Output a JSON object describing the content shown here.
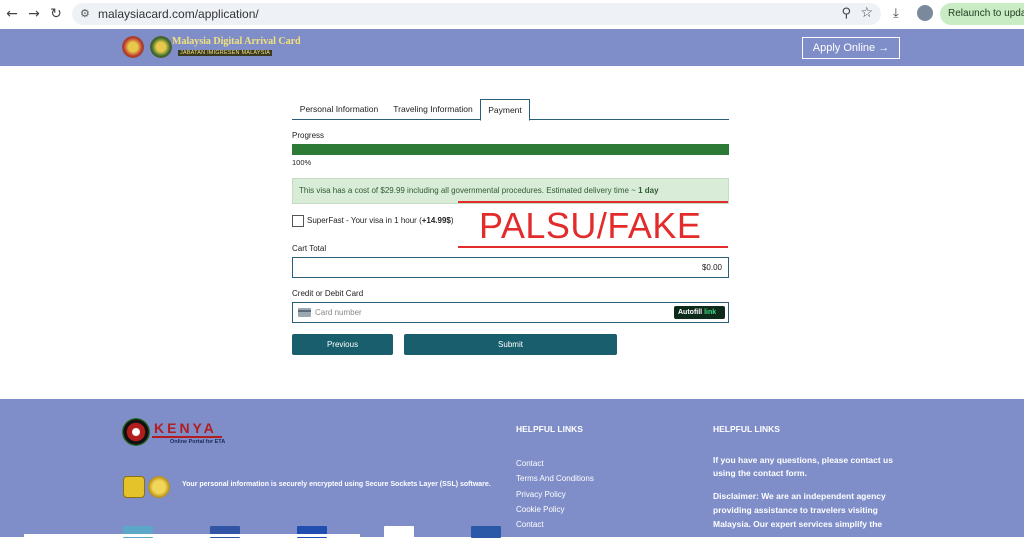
{
  "browser": {
    "url": "malaysiacard.com/application/",
    "relaunch_label": "Relaunch to update"
  },
  "header": {
    "brand_title": "Malaysia Digital Arrival Card",
    "brand_subtitle": "JABATAN IMIGRESEN MALAYSIA",
    "apply_button": "Apply Online →"
  },
  "tabs": [
    {
      "label": "Personal Information"
    },
    {
      "label": "Traveling Information"
    },
    {
      "label": "Payment"
    }
  ],
  "progress": {
    "label": "Progress",
    "value_text": "100%",
    "fraction": 1.0
  },
  "alert": {
    "text_before": "This visa has a cost of $29.99 including all governmental procedures. Estimated delivery time ~ ",
    "text_bold": "1 day"
  },
  "stamp": {
    "text": "PALSU/FAKE",
    "color": "#e32b2b"
  },
  "superfast": {
    "text": "SuperFast - Your visa in 1 hour (",
    "price": "+14.99$",
    "close": ")"
  },
  "cart": {
    "label": "Cart Total",
    "value": "$0.00"
  },
  "card": {
    "label": "Credit or Debit Card",
    "placeholder": "Card number",
    "autofill_label": "Autofill",
    "autofill_link": "link"
  },
  "buttons": {
    "previous": "Previous",
    "submit": "Submit"
  },
  "footer": {
    "logo_text": "KENYA",
    "logo_subtitle": "Online Portal for ETA",
    "ssl_text": "Your personal information is securely encrypted using Secure Sockets Layer (SSL) software.",
    "helpful_links_title": "HELPFUL LINKS",
    "helpful_links_title_2": "HELPFUL LINKS",
    "links": [
      "Contact",
      "Terms And Conditions",
      "Privacy Policy",
      "Cookie Policy",
      "Contact"
    ],
    "contact_note": "If you have any questions, please contact us using the contact form.",
    "disclaimer": "Disclaimer: We are an independent agency providing assistance to travelers visiting Malaysia. Our expert services simplify the"
  },
  "colors": {
    "header_bg": "#7f8ec9",
    "button_bg": "#185e6c",
    "progress_fill": "#2c7a36",
    "alert_bg": "#d9ecd7"
  }
}
